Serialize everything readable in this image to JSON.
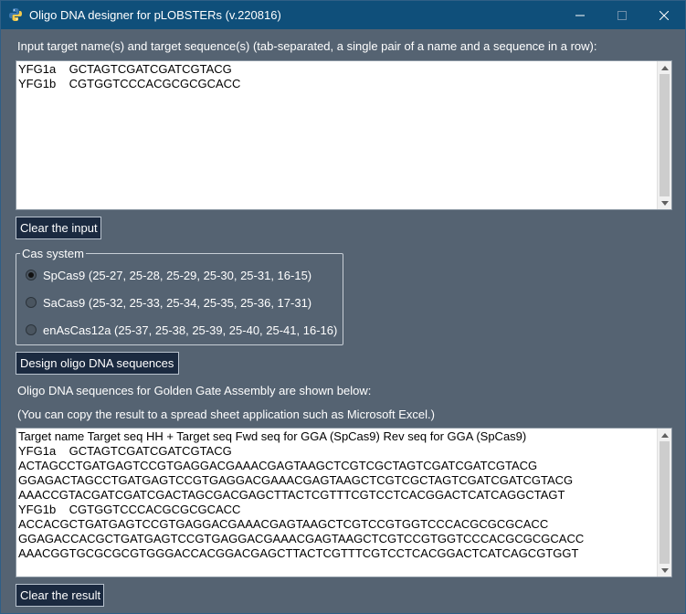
{
  "window": {
    "title": "Oligo DNA designer for pLOBSTERs (v.220816)",
    "title_bar_color": "#0f4f7a",
    "background_color": "#556372"
  },
  "icons": {
    "app": "python-logo-icon",
    "minimize": "minimize-icon",
    "maximize": "maximize-icon",
    "close": "close-icon"
  },
  "input_section": {
    "prompt": "Input target name(s) and target sequence(s) (tab-separated, a single pair of a name and a sequence in a row):",
    "lines": [
      "YFG1a    GCTAGTCGATCGATCGTACG",
      "YFG1b    CGTGGTCCCACGCGCGCACC"
    ],
    "clear_button": "Clear the input"
  },
  "cas_system": {
    "legend": "Cas system",
    "options": [
      {
        "label": "SpCas9 (25-27, 25-28, 25-29, 25-30, 25-31, 16-15)",
        "selected": true
      },
      {
        "label": "SaCas9 (25-32, 25-33, 25-34, 25-35, 25-36, 17-31)",
        "selected": false
      },
      {
        "label": "enAsCas12a (25-37, 25-38, 25-39, 25-40, 25-41, 16-16)",
        "selected": false
      }
    ]
  },
  "design_button": "Design oligo DNA sequences",
  "result_section": {
    "heading": "Oligo DNA sequences for Golden Gate Assembly are shown below:",
    "note": "(You can copy the result to a spread sheet application such as Microsoft Excel.)",
    "lines": [
      "Target name Target seq HH + Target seq Fwd seq for GGA (SpCas9) Rev seq for GGA (SpCas9)",
      "YFG1a    GCTAGTCGATCGATCGTACG",
      "ACTAGCCTGATGAGTCCGTGAGGACGAAACGAGTAAGCTCGTCGCTAGTCGATCGATCGTACG",
      "GGAGACTAGCCTGATGAGTCCGTGAGGACGAAACGAGTAAGCTCGTCGCTAGTCGATCGATCGTACG",
      "AAACCGTACGATCGATCGACTAGCGACGAGCTTACTCGTTTCGTCCTCACGGACTCATCAGGCTAGT",
      "YFG1b    CGTGGTCCCACGCGCGCACC",
      "ACCACGCTGATGAGTCCGTGAGGACGAAACGAGTAAGCTCGTCCGTGGTCCCACGCGCGCACC",
      "GGAGACCACGCTGATGAGTCCGTGAGGACGAAACGAGTAAGCTCGTCCGTGGTCCCACGCGCGCACC",
      "AAACGGTGCGCGCGTGGGACCACGGACGAGCTTACTCGTTTCGTCCTCACGGACTCATCAGCGTGGT"
    ],
    "clear_button": "Clear the result"
  }
}
